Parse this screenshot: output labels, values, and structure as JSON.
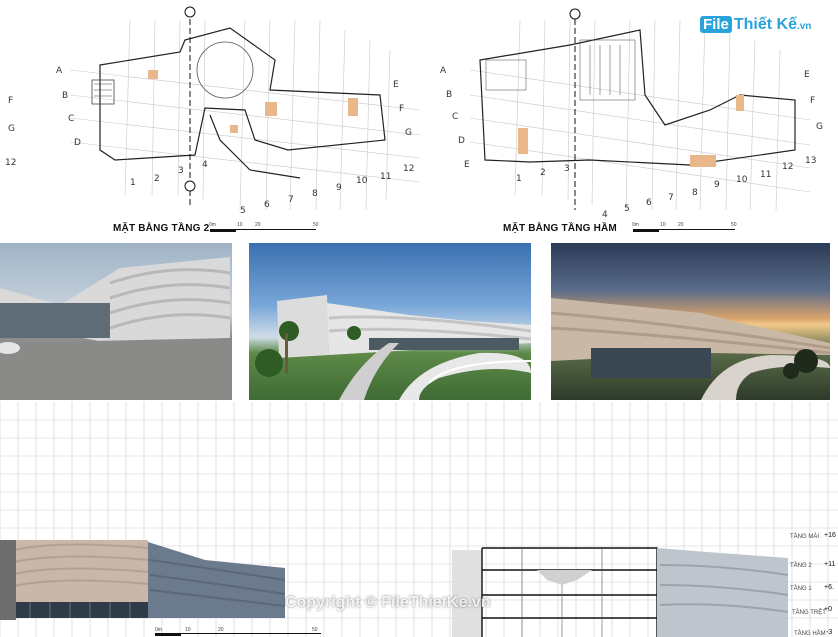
{
  "logo": {
    "mark": "File",
    "name": "Thiết Kế",
    "domain": ".vn"
  },
  "plans": [
    {
      "title": "MẶT BẰNG TẦNG 2",
      "scale": [
        "0m",
        "10",
        "20",
        "50"
      ]
    },
    {
      "title": "MẶT BẰNG TẦNG HẦM",
      "scale": [
        "0m",
        "10",
        "20",
        "50"
      ]
    }
  ],
  "plan1_rows_left": [
    "A",
    "B",
    "C",
    "D"
  ],
  "plan1_rows_right": [
    "E",
    "F",
    "G"
  ],
  "plan1_cols": [
    "1",
    "2",
    "3",
    "4",
    "5",
    "6",
    "7",
    "8",
    "9",
    "10",
    "11",
    "12"
  ],
  "plan2_rows_left": [
    "A",
    "B",
    "C",
    "D",
    "E"
  ],
  "plan2_rows_right": [
    "E",
    "F",
    "G"
  ],
  "plan2_cols": [
    "1",
    "2",
    "3",
    "4",
    "5",
    "6",
    "7",
    "8",
    "9",
    "10",
    "11",
    "12",
    "13"
  ],
  "edge_left": [
    "F",
    "G",
    "12"
  ],
  "section_levels": [
    {
      "name": "TẦNG MÁI",
      "value": "+16"
    },
    {
      "name": "TẦNG 2",
      "value": "+11"
    },
    {
      "name": "TẦNG 1",
      "value": "+6."
    },
    {
      "name": "TẦNG TRỆT",
      "value": "+0"
    },
    {
      "name": "TẦNG HẦM",
      "value": "-3"
    }
  ],
  "elevation_scale": [
    "0m",
    "10",
    "20",
    "50"
  ],
  "watermark": "Copyright © FileThietKe.vn"
}
